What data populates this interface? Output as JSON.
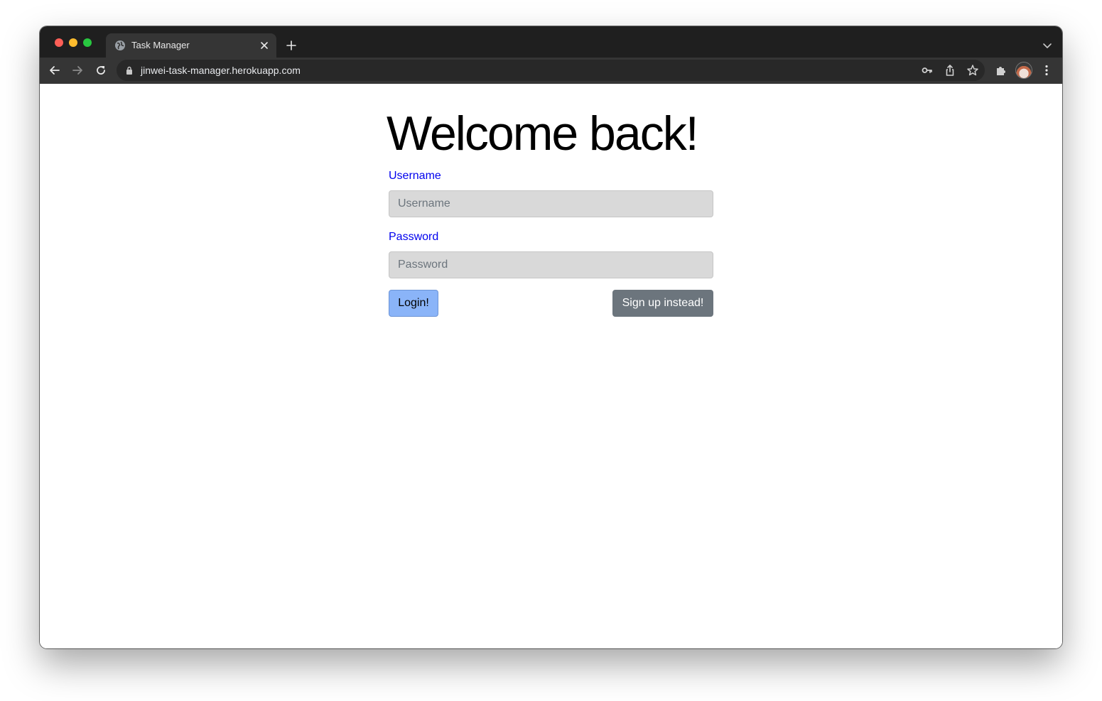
{
  "browser": {
    "tab": {
      "title": "Task Manager"
    },
    "address_bar": {
      "url": "jinwei-task-manager.herokuapp.com"
    },
    "icons": {
      "favicon": "globe-icon",
      "close": "close-icon",
      "new_tab": "plus-icon",
      "back": "arrow-left-icon",
      "forward": "arrow-right-icon",
      "reload": "reload-icon",
      "lock": "lock-icon",
      "passwords": "key-icon",
      "share": "share-icon",
      "bookmark": "star-icon",
      "extensions": "puzzle-icon",
      "profile": "avatar",
      "menu": "kebab-menu-icon"
    }
  },
  "page": {
    "heading": "Welcome back!",
    "username": {
      "label": "Username",
      "placeholder": "Username",
      "value": ""
    },
    "password": {
      "label": "Password",
      "placeholder": "Password",
      "value": ""
    },
    "login_button": "Login!",
    "signup_button": "Sign up instead!"
  },
  "colors": {
    "label": "#0000ee",
    "input_bg": "#d9d9d9",
    "login_button_bg": "#8ab4f8",
    "signup_button_bg": "#6c757d",
    "browser_frame": "#1f1f1f",
    "browser_toolbar": "#353535"
  }
}
